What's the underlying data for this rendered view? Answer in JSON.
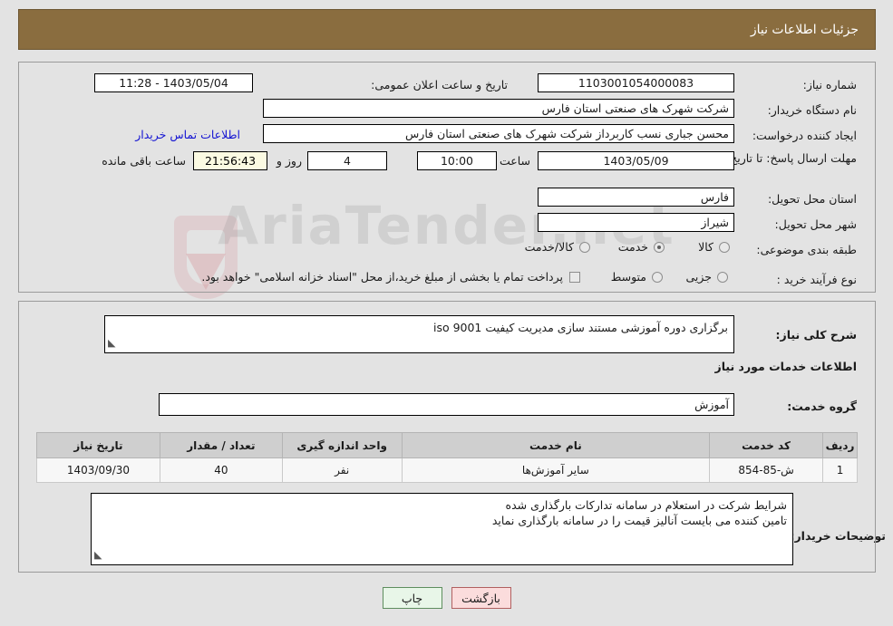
{
  "header": {
    "title": "جزئیات اطلاعات نیاز"
  },
  "form": {
    "need_number_label": "شماره نیاز:",
    "need_number_value": "1103001054000083",
    "announce_label": "تاریخ و ساعت اعلان عمومی:",
    "announce_value": "1403/05/04 - 11:28",
    "buyer_org_label": "نام دستگاه خریدار:",
    "buyer_org_value": "شرکت شهرک های صنعتی استان فارس",
    "creator_label": "ایجاد کننده درخواست:",
    "creator_value": "محسن  جباری نسب کاربرداز شرکت شهرک های صنعتی استان فارس",
    "contact_link": "اطلاعات تماس خریدار",
    "deadline_label": "مهلت ارسال پاسخ: تا تاریخ:",
    "deadline_date": "1403/05/09",
    "hour_label": "ساعت",
    "deadline_time": "10:00",
    "days_value": "4",
    "days_label": "روز و",
    "remaining_value": "21:56:43",
    "remaining_label": "ساعت باقی مانده",
    "province_label": "استان محل تحویل:",
    "province_value": "فارس",
    "city_label": "شهر محل تحویل:",
    "city_value": "شیراز",
    "category_label": "طبقه بندی موضوعی:",
    "category_options": [
      {
        "label": "کالا",
        "selected": false
      },
      {
        "label": "خدمت",
        "selected": true
      },
      {
        "label": "کالا/خدمت",
        "selected": false
      }
    ],
    "process_label": "نوع فرآیند خرید :",
    "process_options": [
      {
        "label": "جزیی",
        "selected": false
      },
      {
        "label": "متوسط",
        "selected": false
      }
    ],
    "treasury_checkbox_label": "پرداخت تمام یا بخشی از مبلغ خرید،از محل \"اسناد خزانه اسلامی\" خواهد بود."
  },
  "description": {
    "general_need_label": "شرح کلی نیاز:",
    "general_need_value": "برگزاری دوره آموزشی مستند سازی مدیریت کیفیت iso 9001",
    "services_section_title": "اطلاعات خدمات مورد نیاز",
    "service_group_label": "گروه خدمت:",
    "service_group_value": "آموزش"
  },
  "table": {
    "columns": [
      "ردیف",
      "کد خدمت",
      "نام خدمت",
      "واحد اندازه گیری",
      "تعداد / مقدار",
      "تاریخ نیاز"
    ],
    "rows": [
      {
        "index": "1",
        "service_code": "ش-85-854",
        "service_name": "سایر آموزش‌ها",
        "unit": "نفر",
        "quantity": "40",
        "need_date": "1403/09/30"
      }
    ]
  },
  "notes": {
    "label": "توضیحات خریدار:",
    "line1": "شرایط شرکت در استعلام در سامانه تدارکات بارگذاری شده",
    "line2": "تامین کننده می بایست آنالیز قیمت را در سامانه بارگذاری نماید"
  },
  "buttons": {
    "print": "چاپ",
    "back": "بازگشت"
  },
  "watermark": {
    "text": "AriaTender.net"
  }
}
